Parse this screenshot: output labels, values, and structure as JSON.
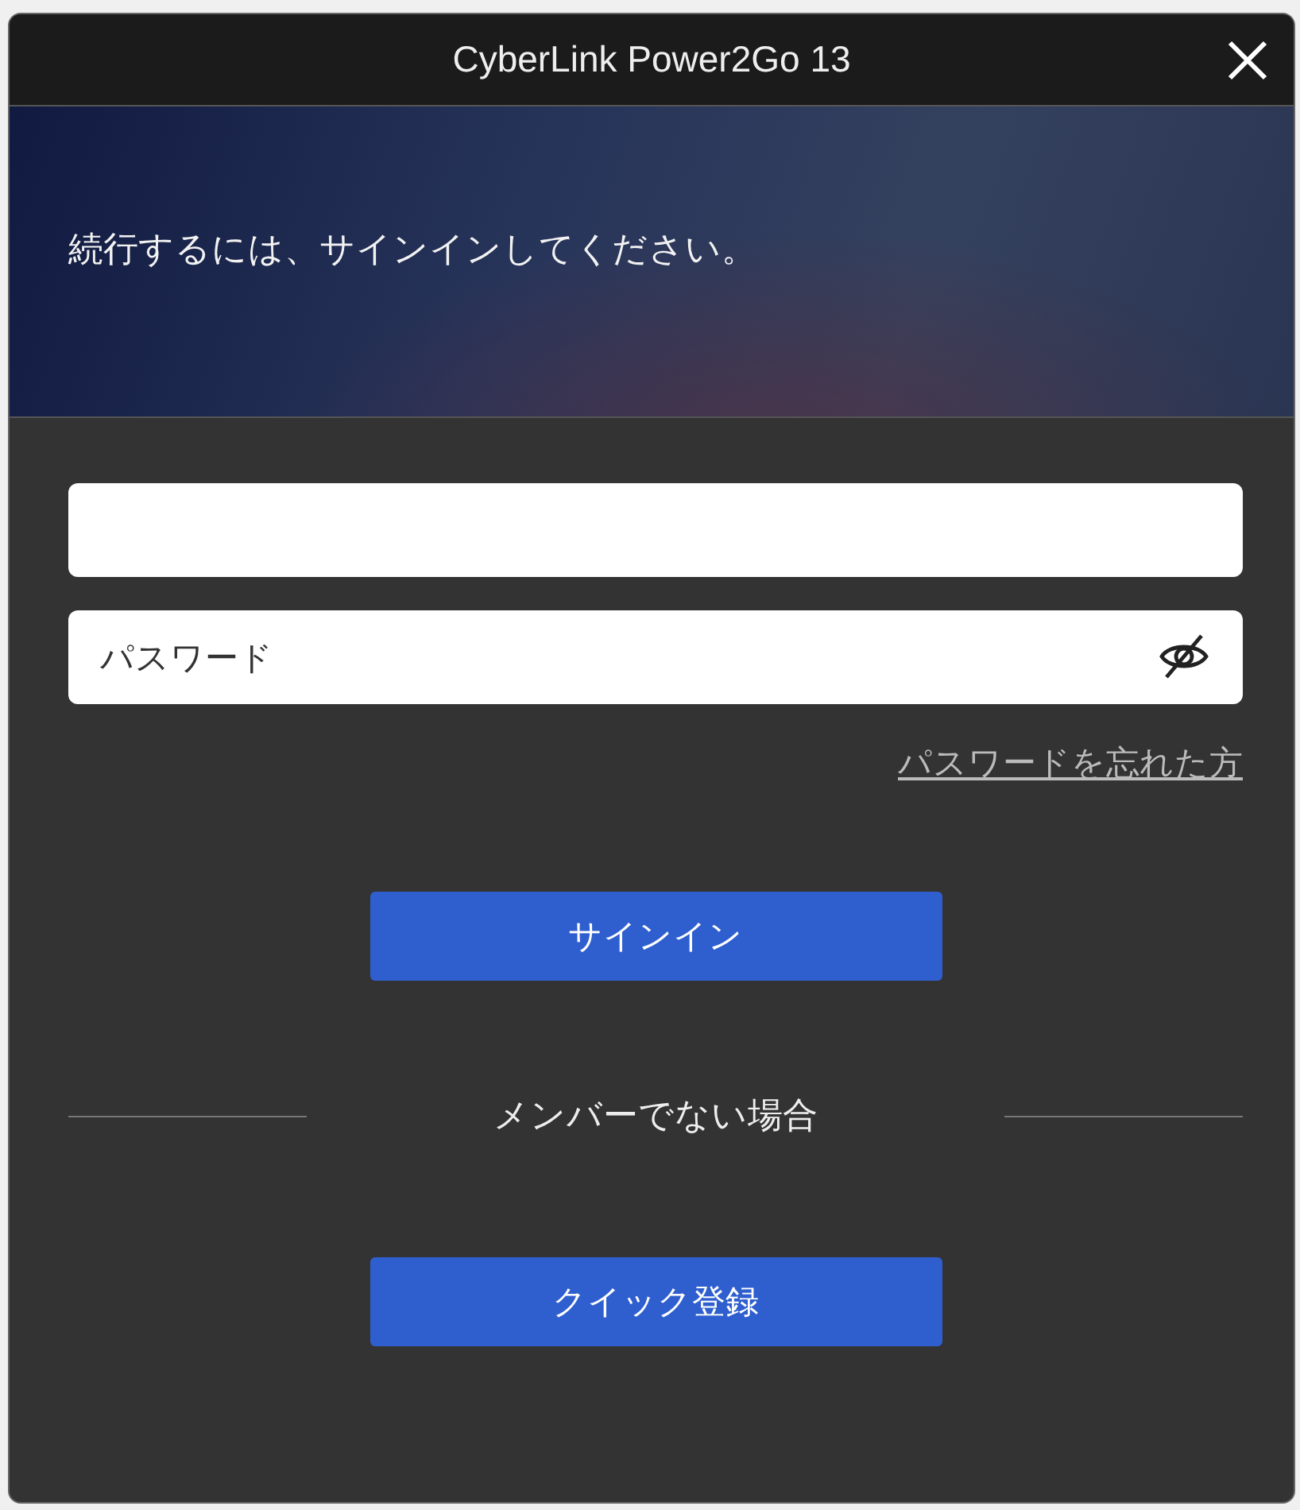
{
  "window": {
    "title": "CyberLink Power2Go 13"
  },
  "banner": {
    "message": "続行するには、サインインしてください。"
  },
  "fields": [
    {
      "kind": "text"
    },
    {
      "kind": "password",
      "placeholder": "パスワード"
    }
  ],
  "forgot_link": "パスワードを忘れた方",
  "sign_in_button": "サインイン",
  "divider_text": "メンバーでない場合",
  "register_button": "クイック登録"
}
